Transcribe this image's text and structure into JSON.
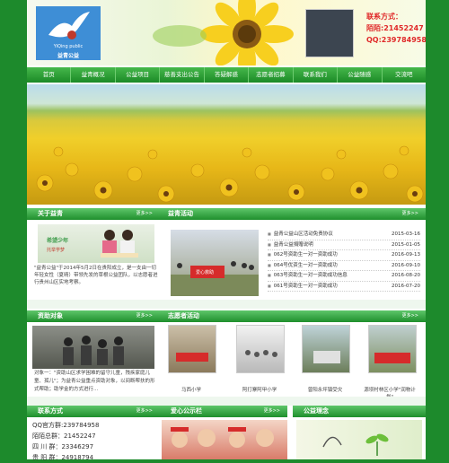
{
  "header": {
    "logo_small_text": "YiQing public",
    "logo_name": "益青公益",
    "contact_title": "联系方式：",
    "contact_phone": "陌陌:21452247",
    "contact_qq": "QQ:239784958"
  },
  "nav": [
    "首页",
    "益青概况",
    "公益项目",
    "慈善支出公告",
    "答疑解惑",
    "志愿者招募",
    "联系我们",
    "公益随感",
    "交流吧"
  ],
  "sections": {
    "about": {
      "title": "关于益青",
      "more": "更多>>",
      "text": "\"益青公益\"于2014年5月2日在贵阳成立，是一支由一切年轻女性（夏晴）带领先发的草根公益团队，以志愿者进行贵州山区实地考察。"
    },
    "activities": {
      "title": "益青活动",
      "more": "更多>>"
    },
    "aid": {
      "title": "资助对象",
      "more": "更多>>",
      "text": "对象一：\"资助山区求学困难的留守儿童，残疾家庭儿童、孤儿\"；为益青公益重点资助对象，以间断帮扶的形式帮助；助学金的方式进行..."
    },
    "volunteers": {
      "title": "志愿者活动",
      "more": "更多>>"
    },
    "contact_section": {
      "title": "联系方式",
      "more": "更多>>"
    },
    "charity_gallery": {
      "title": "爱心公示栏",
      "more": "更多>>"
    },
    "philosophy": {
      "title": "公益理念"
    }
  },
  "activity_image_caption": "爱心救助",
  "news": [
    {
      "title": "益青公益山区活动免责协议",
      "date": "2015-03-16"
    },
    {
      "title": "益青公益捐赠说明",
      "date": "2015-01-05"
    },
    {
      "title": "062号资助生一对一资助成功",
      "date": "2016-09-13"
    },
    {
      "title": "064号优资生一对一资助成功",
      "date": "2016-09-10"
    },
    {
      "title": "063号资助生一对一资助成功信息",
      "date": "2016-08-20"
    },
    {
      "title": "061号资助生一对一资助成功",
      "date": "2016-07-20"
    }
  ],
  "volunteer_items": [
    {
      "caption": "马西小学"
    },
    {
      "caption": "阿打寨阿甲小学"
    },
    {
      "caption": "曾阳永坪镇受灾"
    },
    {
      "caption": "源坝村林区小学\"润物计划\""
    }
  ],
  "contact_info": [
    "QQ官方群:239784958",
    "陌陌总群：21452247",
    "四 川 群：23346297",
    "贵 阳 群：24918794"
  ],
  "colors": {
    "brand_green": "#1d8a2c",
    "accent_red": "#e02a2a",
    "nav_green": "#2e9f37"
  }
}
